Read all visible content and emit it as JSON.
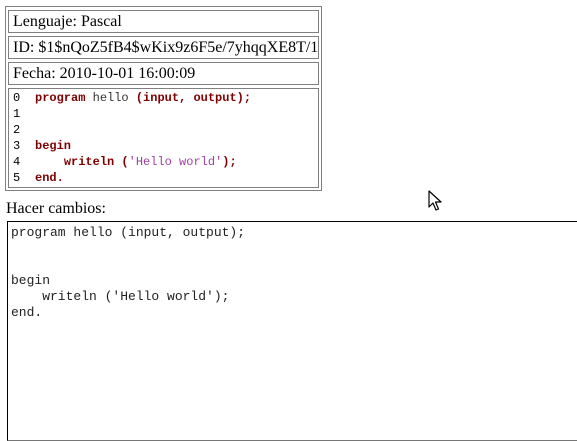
{
  "info": {
    "language": "Lenguaje: Pascal",
    "id": "ID: $1$nQoZ5fB4$wKix9z6F5e/7yhqqXE8T/1",
    "date": "Fecha: 2010-10-01 16:00:09"
  },
  "code": {
    "line_numbers": [
      "0",
      "1",
      "2",
      "3",
      "4",
      "5"
    ],
    "l0": {
      "kw1": "program",
      "t1": " hello ",
      "kw2": "(input, output);"
    },
    "l3": {
      "kw1": "begin"
    },
    "l4": {
      "indent": "    ",
      "kw1": "writeln",
      "p1": " (",
      "s1": "'Hello world'",
      "p2": ");"
    },
    "l5": {
      "kw1": "end."
    }
  },
  "edit_label": "Hacer cambios:",
  "editor_text": "program hello (input, output);\n\n\nbegin\n    writeln ('Hello world');\nend."
}
